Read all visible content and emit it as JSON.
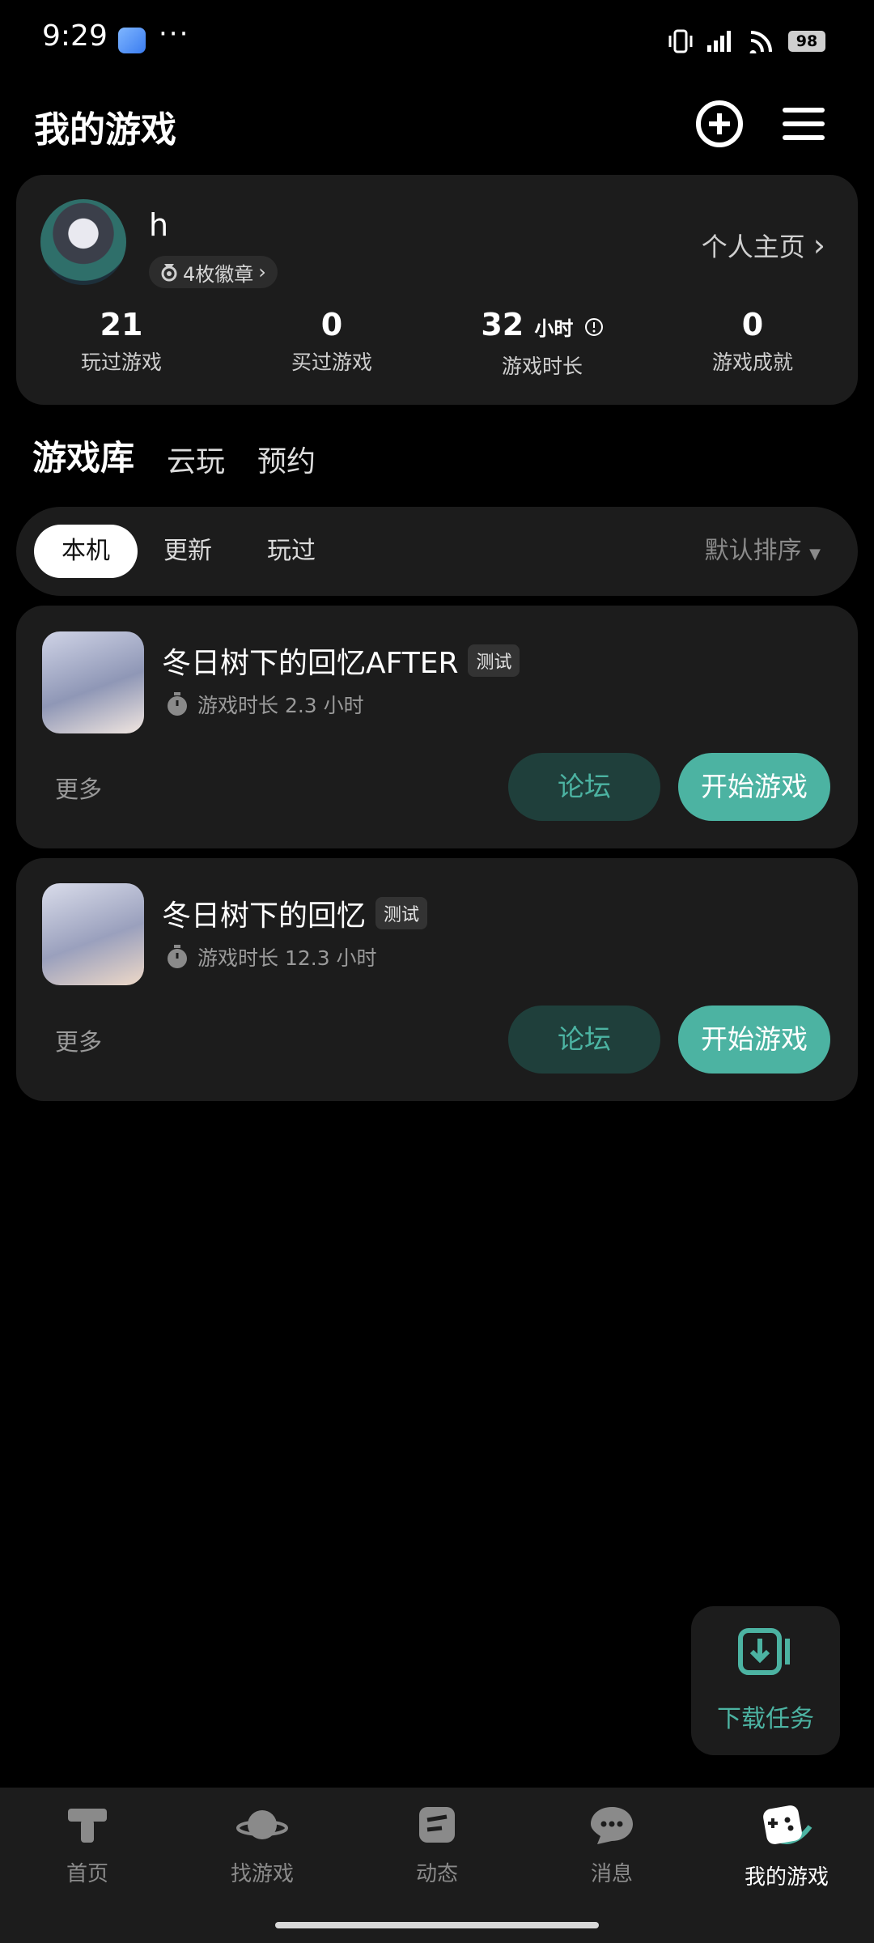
{
  "status_bar": {
    "time": "9:29",
    "dots": "···",
    "battery": "98"
  },
  "header": {
    "title": "我的游戏"
  },
  "profile": {
    "username": "h",
    "badges": "4枚徽章",
    "homepage_link": "个人主页",
    "stats": [
      {
        "value": "21",
        "unit": "",
        "label": "玩过游戏"
      },
      {
        "value": "0",
        "unit": "",
        "label": "买过游戏"
      },
      {
        "value": "32",
        "unit": "小时",
        "label": "游戏时长"
      },
      {
        "value": "0",
        "unit": "",
        "label": "游戏成就"
      }
    ]
  },
  "tabs": [
    "游戏库",
    "云玩",
    "预约"
  ],
  "filters": {
    "chips": [
      "本机",
      "更新",
      "玩过"
    ],
    "sort_label": "默认排序"
  },
  "games": [
    {
      "title": "冬日树下的回忆AFTER",
      "tag": "测试",
      "playtime": "游戏时长 2.3 小时",
      "more": "更多",
      "forum": "论坛",
      "start": "开始游戏"
    },
    {
      "title": "冬日树下的回忆",
      "tag": "测试",
      "playtime": "游戏时长 12.3 小时",
      "more": "更多",
      "forum": "论坛",
      "start": "开始游戏"
    }
  ],
  "download": {
    "label": "下载任务"
  },
  "nav": [
    "首页",
    "找游戏",
    "动态",
    "消息",
    "我的游戏"
  ],
  "colors": {
    "accent": "#4cb3a2",
    "card": "#1c1c1c",
    "background": "#000000"
  }
}
